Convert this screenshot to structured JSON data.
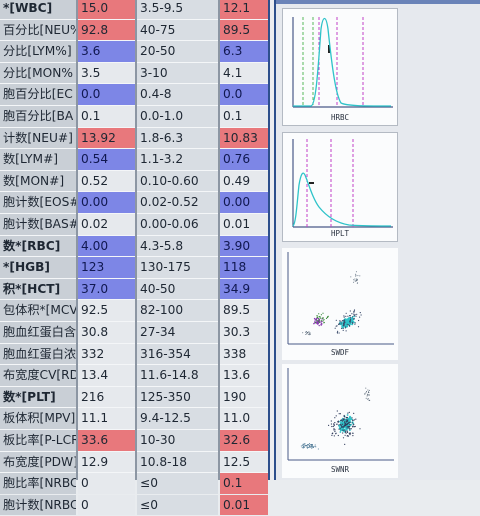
{
  "colors": {
    "high": "#e8787c",
    "low": "#7d86e6",
    "cyan": "#2ec3c9",
    "dash_green": "#57b95a",
    "dash_magenta": "#c040c8",
    "axis": "#4a5a88"
  },
  "rows": [
    {
      "name": "*[WBC]",
      "result": "15.0",
      "result_flag": "high",
      "ref": "3.5-9.5",
      "prev": "12.1",
      "prev_flag": "high",
      "bold": true
    },
    {
      "name": "百分比[NEU%",
      "result": "92.8",
      "result_flag": "high",
      "ref": "40-75",
      "prev": "89.5",
      "prev_flag": "high",
      "bold": false
    },
    {
      "name": "分比[LYM%]",
      "result": "3.6",
      "result_flag": "low",
      "ref": "20-50",
      "prev": "6.3",
      "prev_flag": "low",
      "bold": false
    },
    {
      "name": "分比[MON%",
      "result": "3.5",
      "result_flag": "",
      "ref": "3-10",
      "prev": "4.1",
      "prev_flag": "",
      "bold": false
    },
    {
      "name": "胞百分比[EC",
      "result": "0.0",
      "result_flag": "low",
      "ref": "0.4-8",
      "prev": "0.0",
      "prev_flag": "low",
      "bold": false
    },
    {
      "name": "胞百分比[BA",
      "result": "0.1",
      "result_flag": "",
      "ref": "0.0-1.0",
      "prev": "0.1",
      "prev_flag": "",
      "bold": false
    },
    {
      "name": "计数[NEU#]",
      "result": "13.92",
      "result_flag": "high",
      "ref": "1.8-6.3",
      "prev": "10.83",
      "prev_flag": "high",
      "bold": false
    },
    {
      "name": "数[LYM#]",
      "result": "0.54",
      "result_flag": "low",
      "ref": "1.1-3.2",
      "prev": "0.76",
      "prev_flag": "low",
      "bold": false
    },
    {
      "name": "数[MON#]",
      "result": "0.52",
      "result_flag": "",
      "ref": "0.10-0.60",
      "prev": "0.49",
      "prev_flag": "",
      "bold": false
    },
    {
      "name": "胞计数[EOS#",
      "result": "0.00",
      "result_flag": "low",
      "ref": "0.02-0.52",
      "prev": "0.00",
      "prev_flag": "low",
      "bold": false
    },
    {
      "name": "胞计数[BAS#",
      "result": "0.02",
      "result_flag": "",
      "ref": "0.00-0.06",
      "prev": "0.01",
      "prev_flag": "",
      "bold": false
    },
    {
      "name": "数*[RBC]",
      "result": "4.00",
      "result_flag": "low",
      "ref": "4.3-5.8",
      "prev": "3.90",
      "prev_flag": "low",
      "bold": true
    },
    {
      "name": "*[HGB]",
      "result": "123",
      "result_flag": "low",
      "ref": "130-175",
      "prev": "118",
      "prev_flag": "low",
      "bold": true
    },
    {
      "name": "积*[HCT]",
      "result": "37.0",
      "result_flag": "low",
      "ref": "40-50",
      "prev": "34.9",
      "prev_flag": "low",
      "bold": true
    },
    {
      "name": "包体积*[MCV]",
      "result": "92.5",
      "result_flag": "",
      "ref": "82-100",
      "prev": "89.5",
      "prev_flag": "",
      "bold": false
    },
    {
      "name": "胞血红蛋白含量",
      "result": "30.8",
      "result_flag": "",
      "ref": "27-34",
      "prev": "30.3",
      "prev_flag": "",
      "bold": false
    },
    {
      "name": "胞血红蛋白浓度",
      "result": "332",
      "result_flag": "",
      "ref": "316-354",
      "prev": "338",
      "prev_flag": "",
      "bold": false
    },
    {
      "name": "布宽度CV[RDW",
      "result": "13.4",
      "result_flag": "",
      "ref": "11.6-14.8",
      "prev": "13.6",
      "prev_flag": "",
      "bold": false
    },
    {
      "name": "数*[PLT]",
      "result": "216",
      "result_flag": "",
      "ref": "125-350",
      "prev": "190",
      "prev_flag": "",
      "bold": true
    },
    {
      "name": "板体积[MPV]",
      "result": "11.1",
      "result_flag": "",
      "ref": "9.4-12.5",
      "prev": "11.0",
      "prev_flag": "",
      "bold": false
    },
    {
      "name": "板比率[P-LCR]",
      "result": "33.6",
      "result_flag": "high",
      "ref": "10-30",
      "prev": "32.6",
      "prev_flag": "high",
      "bold": false
    },
    {
      "name": "布宽度[PDW]",
      "result": "12.9",
      "result_flag": "",
      "ref": "10.8-18",
      "prev": "12.5",
      "prev_flag": "",
      "bold": false
    },
    {
      "name": "胞比率[NRBC%",
      "result": "0",
      "result_flag": "",
      "ref": "≤0",
      "prev": "0.1",
      "prev_flag": "high",
      "bold": false
    },
    {
      "name": "胞计数[NRBC#",
      "result": "0",
      "result_flag": "",
      "ref": "≤0",
      "prev": "0.01",
      "prev_flag": "high",
      "bold": false
    }
  ],
  "graphs": [
    {
      "label": "HRBC",
      "kind": "histogram",
      "icon": "rbc-histogram-icon"
    },
    {
      "label": "HPLT",
      "kind": "histogram",
      "icon": "plt-histogram-icon"
    },
    {
      "label": "SWDF",
      "kind": "scattergram",
      "icon": "wdf-scattergram-icon"
    },
    {
      "label": "SWNR",
      "kind": "scattergram",
      "icon": "wnr-scattergram-icon"
    }
  ]
}
